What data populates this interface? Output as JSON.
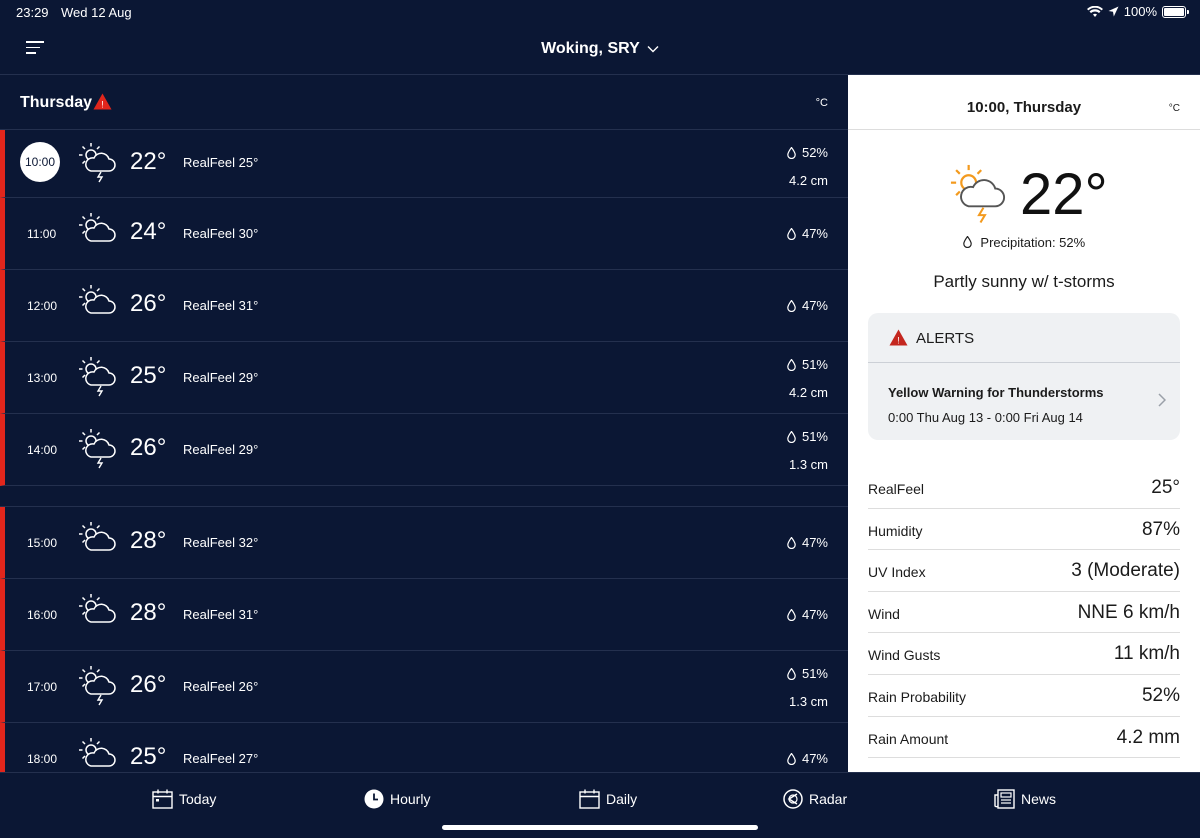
{
  "status": {
    "time": "23:29",
    "date": "Wed 12 Aug",
    "battery": "100%"
  },
  "header": {
    "location": "Woking, SRY"
  },
  "day": {
    "name": "Thursday",
    "unit": "°C"
  },
  "rows": [
    {
      "hour": "10:00",
      "temp": "22°",
      "realfeel": "RealFeel 25°",
      "precip": "52%",
      "amount": "4.2 cm",
      "icon": "partly-sunny-tstorm-icon"
    },
    {
      "hour": "11:00",
      "temp": "24°",
      "realfeel": "RealFeel 30°",
      "precip": "47%",
      "amount": "",
      "icon": "partly-sunny-icon"
    },
    {
      "hour": "12:00",
      "temp": "26°",
      "realfeel": "RealFeel 31°",
      "precip": "47%",
      "amount": "",
      "icon": "partly-sunny-icon"
    },
    {
      "hour": "13:00",
      "temp": "25°",
      "realfeel": "RealFeel 29°",
      "precip": "51%",
      "amount": "4.2 cm",
      "icon": "partly-sunny-tstorm-icon"
    },
    {
      "hour": "14:00",
      "temp": "26°",
      "realfeel": "RealFeel 29°",
      "precip": "51%",
      "amount": "1.3 cm",
      "icon": "partly-sunny-tstorm-icon"
    },
    {
      "hour": "15:00",
      "temp": "28°",
      "realfeel": "RealFeel 32°",
      "precip": "47%",
      "amount": "",
      "icon": "partly-sunny-icon"
    },
    {
      "hour": "16:00",
      "temp": "28°",
      "realfeel": "RealFeel 31°",
      "precip": "47%",
      "amount": "",
      "icon": "partly-sunny-icon"
    },
    {
      "hour": "17:00",
      "temp": "26°",
      "realfeel": "RealFeel 26°",
      "precip": "51%",
      "amount": "1.3 cm",
      "icon": "partly-sunny-tstorm-icon"
    },
    {
      "hour": "18:00",
      "temp": "25°",
      "realfeel": "RealFeel 27°",
      "precip": "47%",
      "amount": "",
      "icon": "partly-sunny-icon"
    }
  ],
  "detail": {
    "header_time": "10:00,",
    "header_day": "Thursday",
    "unit": "°C",
    "temp": "22°",
    "precip": "Precipitation: 52%",
    "phrase": "Partly sunny w/ t-storms",
    "alerts_title": "ALERTS",
    "alert_name": "Yellow Warning for Thunderstorms",
    "alert_time": "0:00 Thu Aug 13 - 0:00 Fri Aug 14",
    "stats": [
      {
        "label": "RealFeel",
        "value": "25°"
      },
      {
        "label": "Humidity",
        "value": "87%"
      },
      {
        "label": "UV Index",
        "value": "3 (Moderate)"
      },
      {
        "label": "Wind",
        "value": "NNE 6 km/h"
      },
      {
        "label": "Wind Gusts",
        "value": "11 km/h"
      },
      {
        "label": "Rain Probability",
        "value": "52%"
      },
      {
        "label": "Rain Amount",
        "value": "4.2 mm"
      }
    ]
  },
  "tabs": [
    {
      "label": "Today",
      "icon": "calendar-icon"
    },
    {
      "label": "Hourly",
      "icon": "clock-icon"
    },
    {
      "label": "Daily",
      "icon": "calendar-icon"
    },
    {
      "label": "Radar",
      "icon": "radar-icon"
    },
    {
      "label": "News",
      "icon": "news-icon"
    }
  ],
  "colors": {
    "background": "#0b1734",
    "accent_red": "#e2261c",
    "sun_orange": "#f39a1e"
  }
}
